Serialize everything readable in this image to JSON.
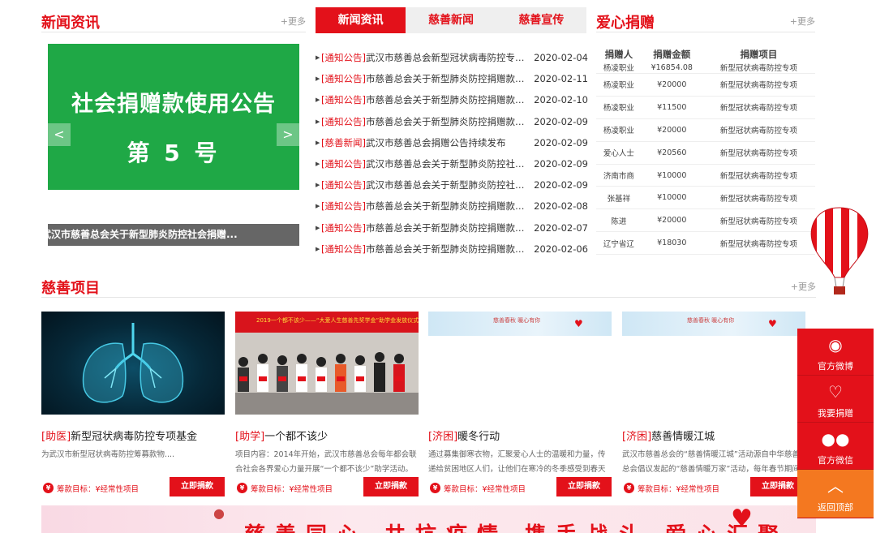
{
  "news_section": {
    "title": "新闻资讯",
    "more": "+更多"
  },
  "carousel": {
    "slide_line1": "社会捐赠款使用公告",
    "slide_line2": "第 5 号",
    "prev": "<",
    "next": ">",
    "caption": "武汉市慈善总会关于新型肺炎防控社会捐赠..."
  },
  "tabs": [
    {
      "label": "新闻资讯",
      "active": true
    },
    {
      "label": "慈善新闻",
      "active": false
    },
    {
      "label": "慈善宣传",
      "active": false
    }
  ],
  "news": [
    {
      "cat": "[通知公告]",
      "title": "武汉市慈善总会新型冠状病毒防控专项...",
      "date": "2020-02-04"
    },
    {
      "cat": "[通知公告]",
      "title": "市慈善总会关于新型肺炎防控捐赠款物...",
      "date": "2020-02-11"
    },
    {
      "cat": "[通知公告]",
      "title": "市慈善总会关于新型肺炎防控捐赠款物...",
      "date": "2020-02-10"
    },
    {
      "cat": "[通知公告]",
      "title": "市慈善总会关于新型肺炎防控捐赠款物...",
      "date": "2020-02-09"
    },
    {
      "cat": "[慈善新闻]",
      "title": "武汉市慈善总会捐赠公告持续发布",
      "date": "2020-02-09"
    },
    {
      "cat": "[通知公告]",
      "title": "武汉市慈善总会关于新型肺炎防控社会...",
      "date": "2020-02-09"
    },
    {
      "cat": "[通知公告]",
      "title": "武汉市慈善总会关于新型肺炎防控社会...",
      "date": "2020-02-09"
    },
    {
      "cat": "[通知公告]",
      "title": "市慈善总会关于新型肺炎防控捐赠款物...",
      "date": "2020-02-08"
    },
    {
      "cat": "[通知公告]",
      "title": "市慈善总会关于新型肺炎防控捐赠款物...",
      "date": "2020-02-07"
    },
    {
      "cat": "[通知公告]",
      "title": "市慈善总会关于新型肺炎防控捐赠款物...",
      "date": "2020-02-06"
    }
  ],
  "donation_section": {
    "title": "爱心捐赠",
    "more": "+更多"
  },
  "donation_table": {
    "headers": [
      "捐赠人",
      "捐赠金额",
      "捐赠项目"
    ],
    "rows": [
      [
        "杨凌职业",
        "¥16854.08",
        "新型冠状病毒防控专项"
      ],
      [
        "杨凌职业",
        "¥20000",
        "新型冠状病毒防控专项"
      ],
      [
        "杨凌职业",
        "¥11500",
        "新型冠状病毒防控专项"
      ],
      [
        "杨凌职业",
        "¥20000",
        "新型冠状病毒防控专项"
      ],
      [
        "爱心人士",
        "¥20560",
        "新型冠状病毒防控专项"
      ],
      [
        "济南市商",
        "¥10000",
        "新型冠状病毒防控专项"
      ],
      [
        "张基祥",
        "¥10000",
        "新型冠状病毒防控专项"
      ],
      [
        "陈进",
        "¥20000",
        "新型冠状病毒防控专项"
      ],
      [
        "辽宁省辽",
        "¥18030",
        "新型冠状病毒防控专项"
      ]
    ]
  },
  "projects_section": {
    "title": "慈善项目",
    "more": "+更多"
  },
  "projects": [
    {
      "tag": "[助医]",
      "name": "新型冠状病毒防控专项基金",
      "desc": "为武汉市新型冠状病毒防控筹募款物....",
      "goal": "筹款目标：¥经常性项目",
      "button": "立即捐款",
      "image": "lungs"
    },
    {
      "tag": "[助学]",
      "name": "一个都不该少",
      "desc": "项目内容：2014年开始，武汉市慈善总会每年都会联合社会各界爱心力量开展“一个都不该少”助学活动。",
      "goal": "筹款目标：¥经常性项目",
      "button": "立即捐款",
      "image": "group",
      "banner": "2019一个都不该少——“大爱人生慈善先奖学金”助学金发放仪式"
    },
    {
      "tag": "[济困]",
      "name": "暖冬行动",
      "desc": "通过募集御寒衣物，汇聚爱心人士的温暖和力量，传递给贫困地区人们，让他们在寒冷的冬季感受到春天",
      "goal": "筹款目标：¥经常性项目",
      "button": "立即捐款",
      "image": "blank",
      "strip": "慈善春秋  暖心有你"
    },
    {
      "tag": "[济困]",
      "name": "慈善情暖江城",
      "desc": "武汉市慈善总会的“慈善情暖江城”活动源自中华慈善总会倡议发起的“慈善情暖万家”活动，每年春节期间",
      "goal": "筹款目标：¥经常性项目",
      "button": "立即捐款",
      "image": "blank",
      "strip": "慈善春秋  暖心有你"
    }
  ],
  "banner": {
    "text": "慈善同心 共抗疫情 携手战斗 爱心汇聚"
  },
  "float_bar": [
    {
      "icon": "weibo-icon",
      "label": "官方微博"
    },
    {
      "icon": "heart-hand-icon",
      "label": "我要捐赠"
    },
    {
      "icon": "wechat-icon",
      "label": "官方微信"
    },
    {
      "icon": "arrow-up-icon",
      "label": "返回顶部"
    }
  ],
  "colors": {
    "brand_red": "#e3111a",
    "green": "#1fa846",
    "orange": "#f47820"
  }
}
